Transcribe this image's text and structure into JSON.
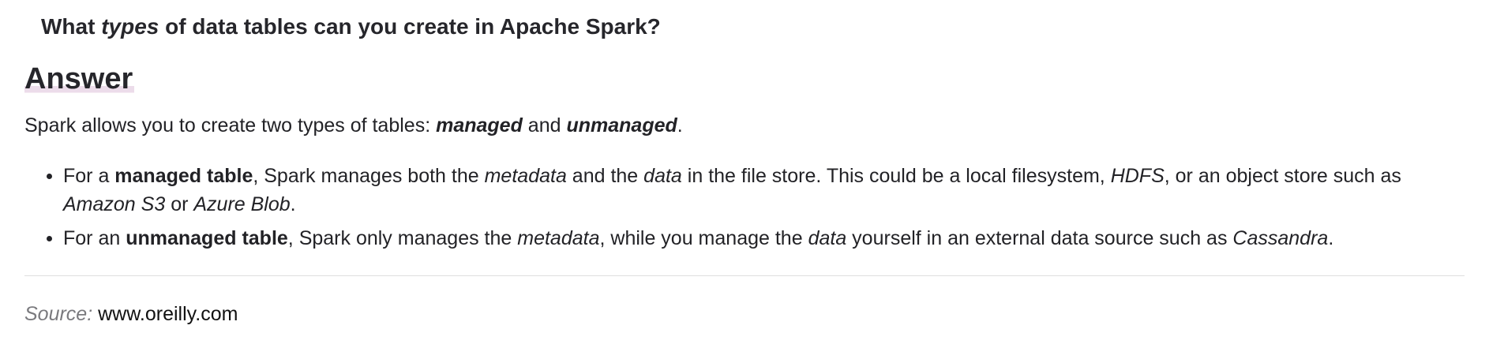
{
  "question": {
    "part1": "What ",
    "emphasis": "types",
    "part2": " of data tables can you create in Apache Spark?"
  },
  "answer_heading": "Answer",
  "intro": {
    "part1": "Spark allows you to create two types of tables: ",
    "term1": "managed",
    "joiner": " and ",
    "term2": "unmanaged",
    "end": "."
  },
  "bullets": [
    {
      "t1": "For a ",
      "b1": "managed table",
      "t2": ", Spark manages both the ",
      "i1": "metadata",
      "t3": " and the ",
      "i2": "data",
      "t4": " in the file store. This could be a local filesystem, ",
      "i3": "HDFS",
      "t5": ", or an object store such as ",
      "i4": "Amazon S3",
      "t6": " or ",
      "i5": "Azure Blob",
      "t7": "."
    },
    {
      "t1": "For an ",
      "b1": "unmanaged table",
      "t2": ", Spark only manages the ",
      "i1": "metadata",
      "t3": ", while you manage the ",
      "i2": "data",
      "t4": " yourself in an external data source such as ",
      "i3": "Cassandra",
      "t5": "."
    }
  ],
  "source": {
    "label": "Source:",
    "value": "www.oreilly.com"
  }
}
